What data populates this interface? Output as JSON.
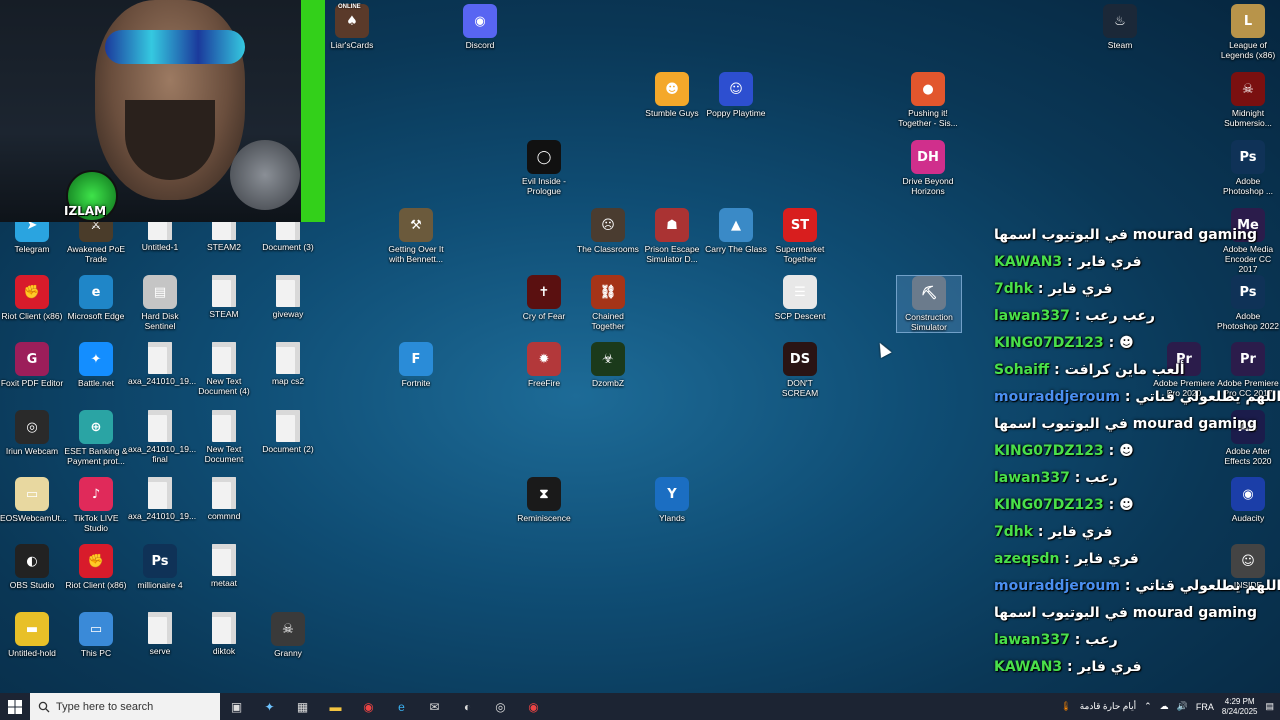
{
  "overlay_brand": "IZLAM",
  "desktop_icons": [
    {
      "label": "Liar'sCards",
      "badge": "ONLINE",
      "color": "#5a3a2a",
      "glyph": "♠"
    },
    {
      "label": "Discord",
      "color": "#5865f2",
      "glyph": "◉"
    },
    {
      "label": "Steam",
      "color": "#1b2838",
      "glyph": "♨"
    },
    {
      "label": "League of Legends (x86)",
      "color": "#b8944a",
      "glyph": "L"
    },
    {
      "label": "Stumble Guys",
      "color": "#f4a82a",
      "glyph": "☻"
    },
    {
      "label": "Poppy Playtime",
      "color": "#2d4fd0",
      "glyph": "☺"
    },
    {
      "label": "Pushing it! Together - Sis...",
      "color": "#e2562d",
      "glyph": "●"
    },
    {
      "label": "Midnight Submersio...",
      "color": "#7a1010",
      "glyph": "☠"
    },
    {
      "label": "Evil Inside - Prologue",
      "color": "#111",
      "glyph": "◯"
    },
    {
      "label": "Drive Beyond Horizons",
      "color": "#d02f8c",
      "glyph": "DH"
    },
    {
      "label": "Adobe Photoshop ...",
      "color": "#0f3257",
      "glyph": "Ps"
    },
    {
      "label": "Telegram",
      "color": "#2aa4e0",
      "glyph": "➤"
    },
    {
      "label": "Awakened PoE Trade",
      "color": "#4a3c2a",
      "glyph": "⚔"
    },
    {
      "label": "Untitled-1",
      "doc": true
    },
    {
      "label": "STEAM2",
      "doc": true
    },
    {
      "label": "Document (3)",
      "doc": true
    },
    {
      "label": "Getting Over It with Bennett...",
      "color": "#6b5a3c",
      "glyph": "⚒"
    },
    {
      "label": "The Classrooms",
      "color": "#4a3c30",
      "glyph": "☹"
    },
    {
      "label": "Prison Escape Simulator D...",
      "color": "#a33",
      "glyph": "☗"
    },
    {
      "label": "Carry The Glass",
      "color": "#3a8ac7",
      "glyph": "▲"
    },
    {
      "label": "Supermarket Together",
      "color": "#d81e1e",
      "glyph": "ST"
    },
    {
      "label": "Adobe Media Encoder CC 2017",
      "color": "#2b1c4b",
      "glyph": "Me"
    },
    {
      "label": "Riot Client (x86)",
      "color": "#d81b2b",
      "glyph": "✊"
    },
    {
      "label": "Microsoft Edge",
      "color": "#1f86c8",
      "glyph": "e"
    },
    {
      "label": "Hard Disk Sentinel",
      "color": "#c5c5c5",
      "glyph": "▤"
    },
    {
      "label": "STEAM",
      "doc": true
    },
    {
      "label": "giveway",
      "doc": true
    },
    {
      "label": "Cry of Fear",
      "color": "#5a1010",
      "glyph": "✝"
    },
    {
      "label": "Chained Together",
      "color": "#a53418",
      "glyph": "⛓"
    },
    {
      "label": "SCP Descent",
      "color": "#e8e8e8",
      "glyph": "☰"
    },
    {
      "label": "Construction Simulator",
      "color": "#6b7b8c",
      "glyph": "⛏",
      "selected": true
    },
    {
      "label": "Adobe Photoshop 2022",
      "color": "#0f3257",
      "glyph": "Ps"
    },
    {
      "label": "Foxit PDF Editor",
      "color": "#9c1e5a",
      "glyph": "G"
    },
    {
      "label": "Battle.net",
      "color": "#148eff",
      "glyph": "✦"
    },
    {
      "label": "axa_241010_19...",
      "doc": true
    },
    {
      "label": "New Text Document (4)",
      "doc": true
    },
    {
      "label": "map cs2",
      "doc": true
    },
    {
      "label": "Fortnite",
      "color": "#2a8cd8",
      "glyph": "F"
    },
    {
      "label": "FreeFire",
      "color": "#b3383a",
      "glyph": "✹"
    },
    {
      "label": "DzombZ",
      "color": "#1b3a1b",
      "glyph": "☣"
    },
    {
      "label": "DON'T SCREAM",
      "color": "#2a1414",
      "glyph": "DS"
    },
    {
      "label": "Adobe Premiere Pro 2020",
      "color": "#2b1c4b",
      "glyph": "Pr"
    },
    {
      "label": "Adobe Premiere Pro CC 2017",
      "color": "#2b1c4b",
      "glyph": "Pr"
    },
    {
      "label": "Iriun Webcam",
      "color": "#2a2a2a",
      "glyph": "◎"
    },
    {
      "label": "ESET Banking & Payment prot...",
      "color": "#2aa4a4",
      "glyph": "⊕"
    },
    {
      "label": "axa_241010_19... final",
      "doc": true
    },
    {
      "label": "New Text Document",
      "doc": true
    },
    {
      "label": "Document (2)",
      "doc": true
    },
    {
      "label": "Adobe After Effects 2020",
      "color": "#1b1c4b",
      "glyph": "Ae"
    },
    {
      "label": "EOSWebcamUt...",
      "color": "#e8d8a0",
      "glyph": "▭"
    },
    {
      "label": "TikTok LIVE Studio",
      "color": "#e02a5a",
      "glyph": "♪"
    },
    {
      "label": "axa_241010_19...",
      "doc": true
    },
    {
      "label": "commnd",
      "doc": true
    },
    {
      "label": "Reminiscence",
      "color": "#1a1a1a",
      "glyph": "⧗"
    },
    {
      "label": "Ylands",
      "color": "#1b6ec2",
      "glyph": "Y"
    },
    {
      "label": "Audacity",
      "color": "#1b3ea8",
      "glyph": "◉"
    },
    {
      "label": "OBS Studio",
      "color": "#222",
      "glyph": "◐"
    },
    {
      "label": "Riot Client (x86)",
      "color": "#d81b2b",
      "glyph": "✊"
    },
    {
      "label": "millionaire 4",
      "color": "#0f3257",
      "glyph": "Ps"
    },
    {
      "label": "metaat",
      "doc": true
    },
    {
      "label": "INSIDE",
      "color": "#444",
      "glyph": "☺"
    },
    {
      "label": "Untitled-hold",
      "color": "#e8c028",
      "glyph": "▬"
    },
    {
      "label": "This PC",
      "color": "#3a8ad8",
      "glyph": "▭"
    },
    {
      "label": "serve",
      "doc": true
    },
    {
      "label": "diktok",
      "doc": true
    },
    {
      "label": "Granny",
      "color": "#3a3a3a",
      "glyph": "☠"
    }
  ],
  "chat": [
    {
      "name": "",
      "text": "في اليوتيوب اسمها mourad gaming",
      "color": "#49e04a"
    },
    {
      "name": "KAWAN3",
      "text": " : فري فاير",
      "color": "#49e04a"
    },
    {
      "name": "7dhk",
      "text": " : فري فاير",
      "color": "#49e04a"
    },
    {
      "name": "lawan337",
      "text": " : رعب رعب",
      "color": "#49e04a"
    },
    {
      "name": "KING07DZ123",
      "text": " : ☻",
      "color": "#49e04a"
    },
    {
      "name": "Sohaiff",
      "text": " : ألعب ماين كرافت",
      "color": "#49e04a"
    },
    {
      "name": "mouraddjeroum",
      "text": " : اللهم يطلعولي قناتي",
      "color": "#4a8ff0"
    },
    {
      "name": "",
      "text": "في اليوتيوب اسمها mourad gaming",
      "color": "#49e04a"
    },
    {
      "name": "KING07DZ123",
      "text": " : ☻",
      "color": "#49e04a"
    },
    {
      "name": "lawan337",
      "text": " : رعب",
      "color": "#49e04a"
    },
    {
      "name": "KING07DZ123",
      "text": " : ☻",
      "color": "#49e04a"
    },
    {
      "name": "7dhk",
      "text": " : فري فاير",
      "color": "#49e04a"
    },
    {
      "name": "azeqsdn",
      "text": " : فري فاير",
      "color": "#49e04a"
    },
    {
      "name": "mouraddjeroum",
      "text": " : اللهم يطلعولي قناتي",
      "color": "#4a8ff0"
    },
    {
      "name": "",
      "text": "في اليوتيوب اسمها mourad gaming",
      "color": "#49e04a"
    },
    {
      "name": "lawan337",
      "text": " : رعب",
      "color": "#49e04a"
    },
    {
      "name": "KAWAN3",
      "text": " : فري فاير",
      "color": "#49e04a"
    }
  ],
  "taskbar": {
    "search_placeholder": "Type here to search",
    "weather": "أيام حارة قادمة",
    "lang": "FRA",
    "time": "4:29 PM",
    "date": "8/24/2025"
  }
}
